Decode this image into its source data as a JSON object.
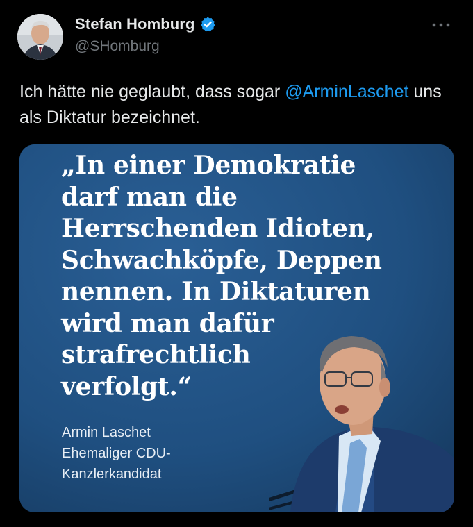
{
  "tweet": {
    "author": {
      "display_name": "Stefan Homburg",
      "handle": "@SHomburg",
      "avatar_icon": "avatar-photo",
      "verified_icon": "verified-badge-icon",
      "verified_color": "#1d9bf0"
    },
    "more_icon": "more-options-icon",
    "text_before": "Ich hätte nie geglaubt, dass sogar ",
    "mention": "@ArminLaschet",
    "text_after": " uns als Diktatur bezeichnet.",
    "mention_color": "#1d9bf0"
  },
  "media": {
    "background_color": "#1f4f7f",
    "quote": "„In einer Demokratie\ndarf man die\nHerrschenden Idioten,\nSchwachköpfe, Deppen\nnennen. In Diktaturen\nwird man dafür\nstrafrechtlich\nverfolgt.“",
    "attribution_name": "Armin Laschet",
    "attribution_role_line1": "Ehemaliger CDU-",
    "attribution_role_line2": "Kanzlerkandidat",
    "portrait_icon": "speaker-portrait-photo"
  }
}
